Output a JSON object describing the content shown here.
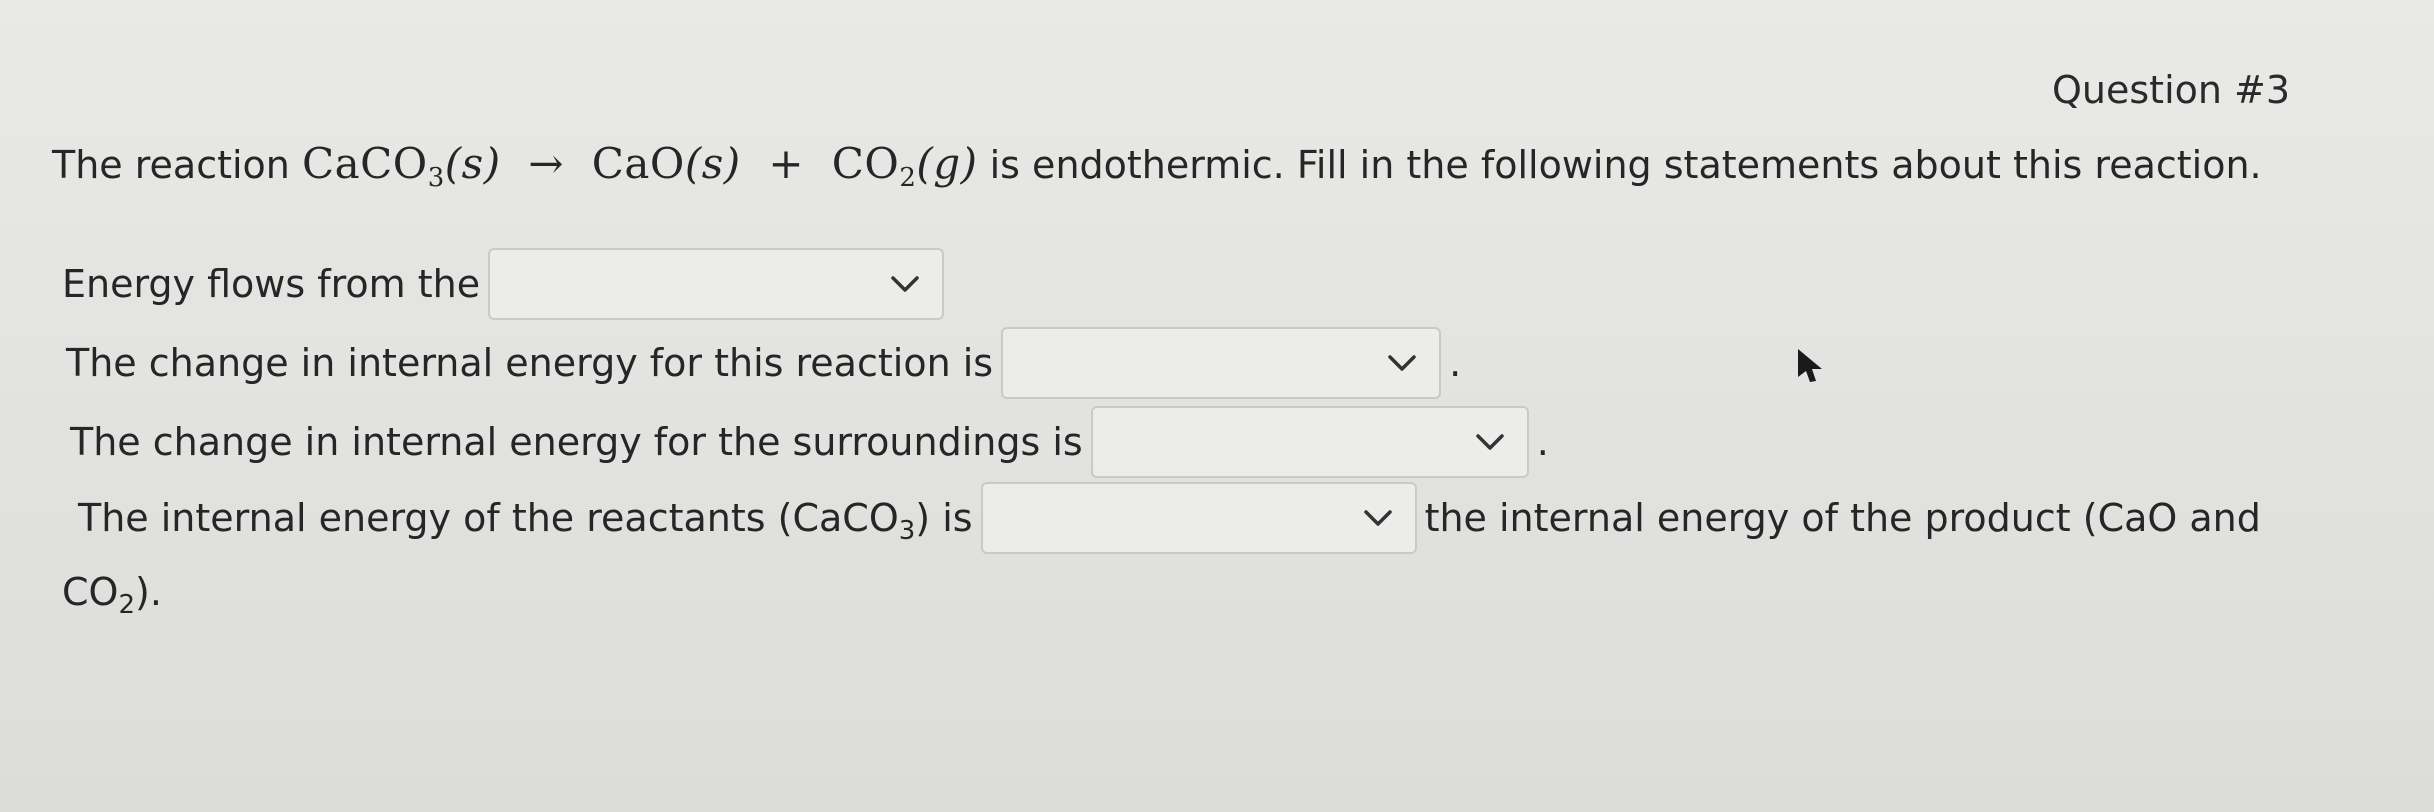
{
  "question": {
    "number_label": "Question #3"
  },
  "intro": {
    "prefix": "The reaction ",
    "reactant_formula": "CaCO",
    "reactant_sub": "3",
    "reactant_state": "(s)",
    "arrow": "→",
    "product1": "CaO",
    "product1_state": "(s)",
    "plus": "+",
    "product2_formula": "CO",
    "product2_sub": "2",
    "product2_state": "(g)",
    "suffix": " is endothermic. Fill in the following statements about this reaction."
  },
  "statements": {
    "s1": {
      "text": "Energy flows from the",
      "dropdown_value": ""
    },
    "s2": {
      "text": "The change in internal energy for this reaction is",
      "dropdown_value": "",
      "after": "."
    },
    "s3": {
      "text": "The change in internal energy for the surroundings is",
      "dropdown_value": "",
      "after": "."
    },
    "s4": {
      "text_before": "The internal energy of the reactants (CaCO",
      "text_before_sub": "3",
      "text_before_end": ") is",
      "dropdown_value": "",
      "text_after": "the internal energy of the product (CaO and",
      "wrap_formula": "CO",
      "wrap_sub": "2",
      "wrap_end": ")."
    }
  },
  "icons": {
    "dropdown": "chevron-down-icon",
    "pointer": "mouse-pointer-icon"
  },
  "colors": {
    "background": "#e5e5e3",
    "text": "#262626",
    "dropdown_bg": "#ececea",
    "dropdown_border": "#c9c9c7"
  }
}
